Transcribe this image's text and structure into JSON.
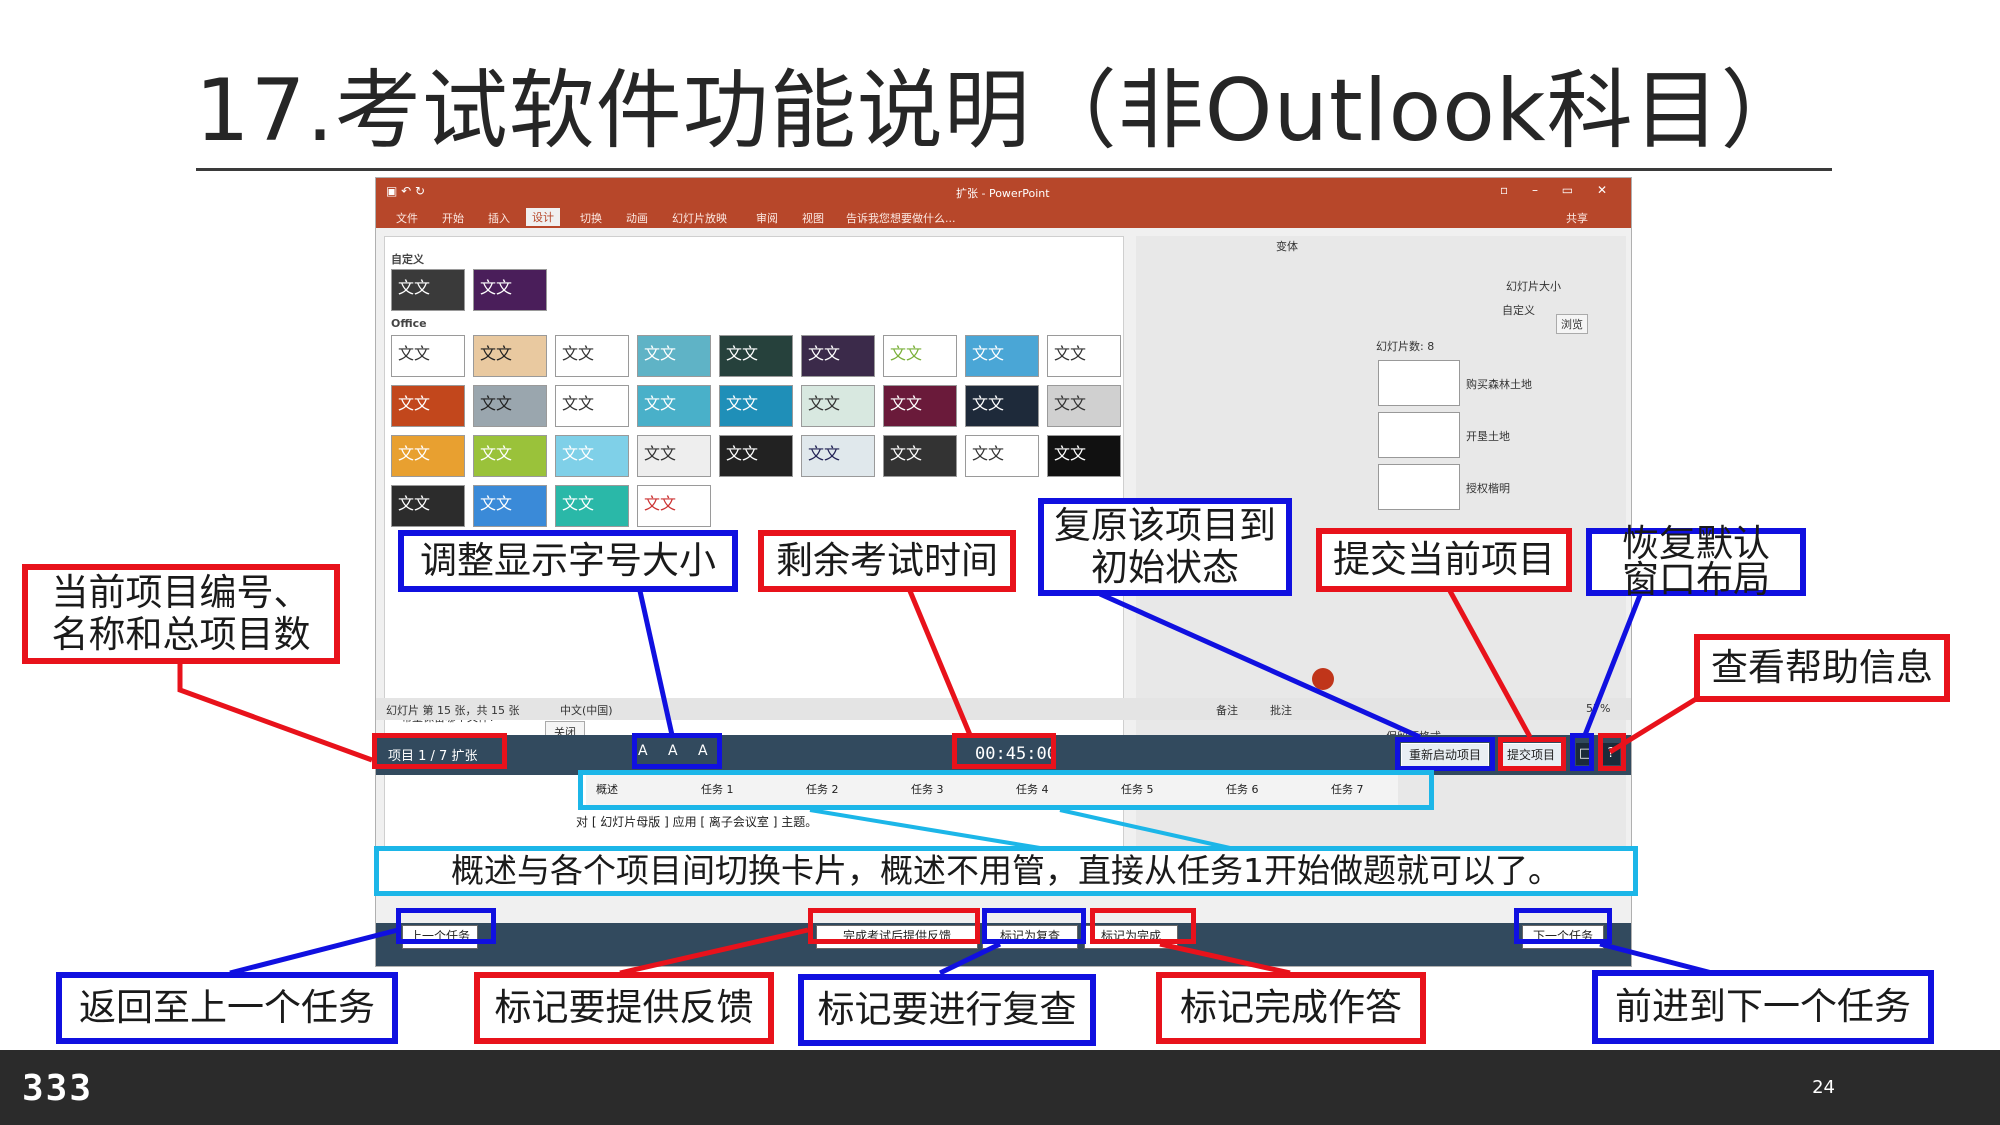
{
  "slide": {
    "title": "17.考试软件功能说明（非Outlook科目）",
    "page_number": "24",
    "logo_text": "333"
  },
  "screenshot": {
    "app_title": "扩张 - PowerPoint",
    "ribbon_tabs": [
      "文件",
      "开始",
      "插入",
      "设计",
      "切换",
      "动画",
      "幻灯片放映",
      "审阅",
      "视图",
      "告诉我您想要做什么..."
    ],
    "active_tab": "设计",
    "share_label": "共享",
    "gallery_custom_label": "自定义",
    "gallery_office_label": "Office",
    "theme_thumb_text": "文文",
    "variant_label": "变体",
    "customize_label": "自定义",
    "slide_size_label": "幻灯片大小",
    "format_bg_label": "设置背景格式",
    "browse_label": "浏览",
    "slide_count_label": "幻灯片数: 8",
    "slide_labels": [
      "购买森林土地",
      "开垦土地",
      "授权楷明"
    ],
    "keep_format_label": "保留源格式",
    "want_keep_label": "希望保留哪个文件?",
    "close_label": "关闭",
    "status_left": "幻灯片 第 15 张，共 15 张",
    "status_lang": "中文(中国)",
    "status_notes": "备注",
    "status_comments": "批注",
    "zoom": "57%",
    "project_label": "项目 1 / 7  扩张",
    "font_size_ctl": "A A A",
    "timer": "00:45:00",
    "restart_button": "重新启动项目",
    "submit_button": "提交项目",
    "help_button": "?",
    "layout_button": "□",
    "tabs": [
      "概述",
      "任务 1",
      "任务 2",
      "任务 3",
      "任务 4",
      "任务 5",
      "任务 6",
      "任务 7"
    ],
    "task_description": "对 [ 幻灯片母版 ] 应用 [ 离子会议室 ] 主题。",
    "prev_button": "上一个任务",
    "feedback_button": "完成考试后提供反馈",
    "review_button": "标记为复查",
    "complete_button": "标记为完成",
    "next_button": "下一个任务"
  },
  "callouts": {
    "project_info": "当前项目编号、\n名称和总项目数",
    "font_size": "调整显示字号大小",
    "remaining_time": "剩余考试时间",
    "restore_project": "复原该项目到\n初始状态",
    "submit_project": "提交当前项目",
    "restore_layout": "恢复默认\n窗口布局",
    "help_info": "查看帮助信息",
    "tabs_note": "概述与各个项目间切换卡片，概述不用管，直接从任务1开始做题就可以了。",
    "prev_task": "返回至上一个任务",
    "feedback": "标记要提供反馈",
    "review": "标记要进行复查",
    "complete": "标记完成作答",
    "next_task": "前进到下一个任务"
  },
  "colors": {
    "red_callout": "#e8121b",
    "blue_callout": "#1010e0",
    "cyan_callout": "#1cb6e8",
    "powerpoint_accent": "#b7472a",
    "exam_bar": "#324a5e"
  }
}
